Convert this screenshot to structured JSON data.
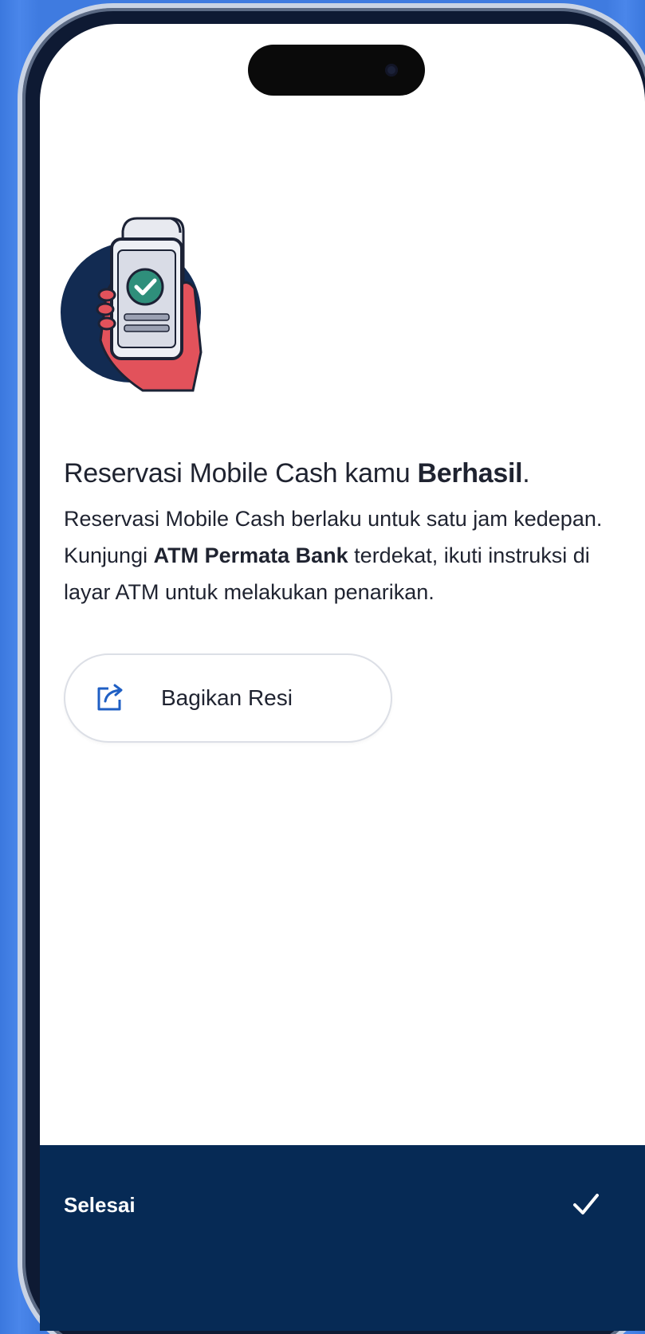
{
  "content": {
    "title_prefix": "Reservasi Mobile Cash kamu ",
    "title_bold": "Berhasil",
    "title_suffix": ".",
    "desc_part1": "Reservasi Mobile Cash berlaku untuk satu jam kedepan. Kunjungi ",
    "desc_bold": "ATM Permata Bank",
    "desc_part2": " terdekat, ikuti instruksi di layar ATM untuk melakukan penarikan."
  },
  "share_button": {
    "label": "Bagikan Resi",
    "icon": "share-icon"
  },
  "footer": {
    "label": "Selesai",
    "icon": "check-icon"
  },
  "colors": {
    "background": "#3f7be0",
    "footer": "#062a55",
    "illustration_circle": "#122b52",
    "hand": "#e2525b",
    "check_badge": "#2f8f7b"
  }
}
